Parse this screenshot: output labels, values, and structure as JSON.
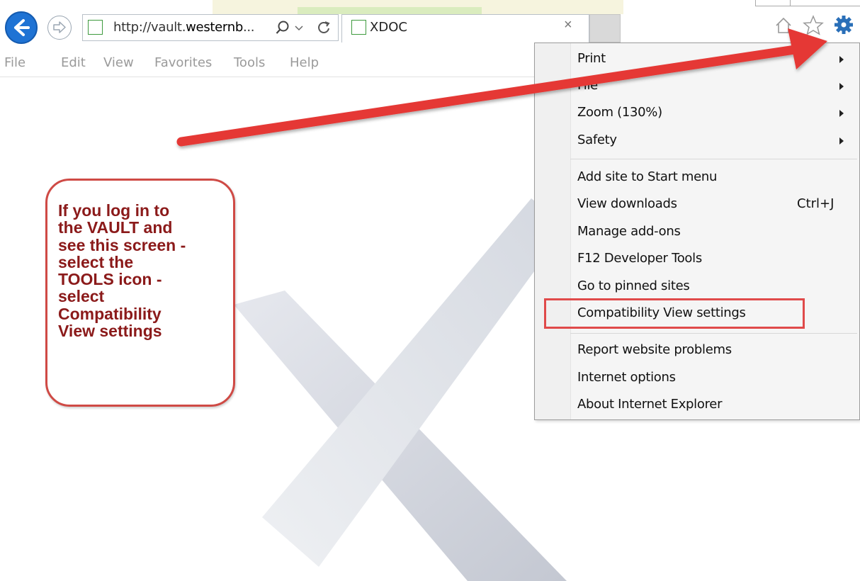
{
  "browser": {
    "address_url_prefix": "http://vault.",
    "address_url_bold": "westernb",
    "address_url_suffix": "...",
    "tab_title": "XDOC"
  },
  "menubar": {
    "items": [
      "File",
      "Edit",
      "View",
      "Favorites",
      "Tools",
      "Help"
    ]
  },
  "tools_menu": {
    "items": [
      {
        "label": "Print",
        "submenu": true
      },
      {
        "label": "File",
        "submenu": true
      },
      {
        "label": "Zoom (130%)",
        "submenu": true
      },
      {
        "label": "Safety",
        "submenu": true
      },
      {
        "label": "Add site to Start menu"
      },
      {
        "label": "View downloads",
        "shortcut": "Ctrl+J"
      },
      {
        "label": "Manage add-ons"
      },
      {
        "label": "F12 Developer Tools"
      },
      {
        "label": "Go to pinned sites"
      },
      {
        "label": "Compatibility View settings",
        "highlighted": true
      },
      {
        "label": "Report website problems"
      },
      {
        "label": "Internet options"
      },
      {
        "label": "About Internet Explorer"
      }
    ]
  },
  "annotation": {
    "callout_text": "If you log in to\nthe VAULT and\nsee this screen -\nselect the\nTOOLS icon -\nselect\nCompatibility\n View settings",
    "arrow_color": "#e53935",
    "box_color": "#e04a4a",
    "text_color": "#8b1a1a"
  },
  "icons": [
    "back-arrow-icon",
    "forward-arrow-icon",
    "page-icon",
    "search-icon",
    "dropdown-arrow-icon",
    "refresh-icon",
    "home-icon",
    "star-icon",
    "gear-icon",
    "submenu-arrow-icon"
  ]
}
